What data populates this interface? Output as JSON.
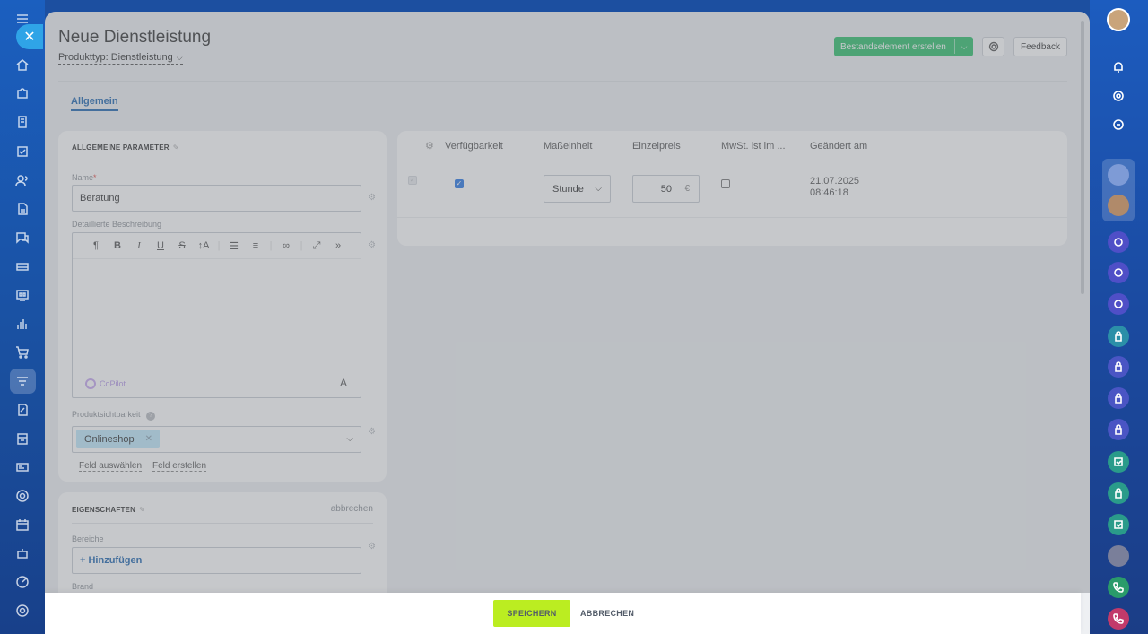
{
  "header": {
    "title": "Neue Dienstleistung",
    "product_type": "Produkttyp: Dienstleistung",
    "create_button": "Bestandselement erstellen",
    "feedback_button": "Feedback"
  },
  "tabs": [
    {
      "label": "Allgemein",
      "active": true
    }
  ],
  "general": {
    "heading": "ALLGEMEINE PARAMETER",
    "name_label": "Name",
    "name_required_mark": "*",
    "name_value": "Beratung",
    "description_label": "Detaillierte Beschreibung",
    "copilot_label": "CoPilot",
    "font_button": "A",
    "visibility_label": "Produktsichtbarkeit",
    "visibility_tag": "Onlineshop",
    "select_field_link": "Feld auswählen",
    "create_field_link": "Feld erstellen"
  },
  "properties": {
    "heading": "EIGENSCHAFTEN",
    "cancel_link": "abbrechen",
    "sections_label": "Bereiche",
    "add_button": "+ Hinzufügen",
    "brand_label": "Brand"
  },
  "table": {
    "columns": [
      "Verfügbarkeit",
      "Maßeinheit",
      "Einzelpreis",
      "MwSt. ist im ...",
      "Geändert am"
    ],
    "row": {
      "available": true,
      "unit": "Stunde",
      "price": "50",
      "currency": "€",
      "vat_included": false,
      "changed_date": "21.07.2025",
      "changed_time": "08:46:18"
    }
  },
  "footer": {
    "save": "SPEICHERN",
    "cancel": "ABBRECHEN"
  },
  "colors": {
    "primary_green": "#2fc06b",
    "save_lime": "#bbed21",
    "link_blue": "#2067b0",
    "checkbox_blue": "#2877e6"
  }
}
